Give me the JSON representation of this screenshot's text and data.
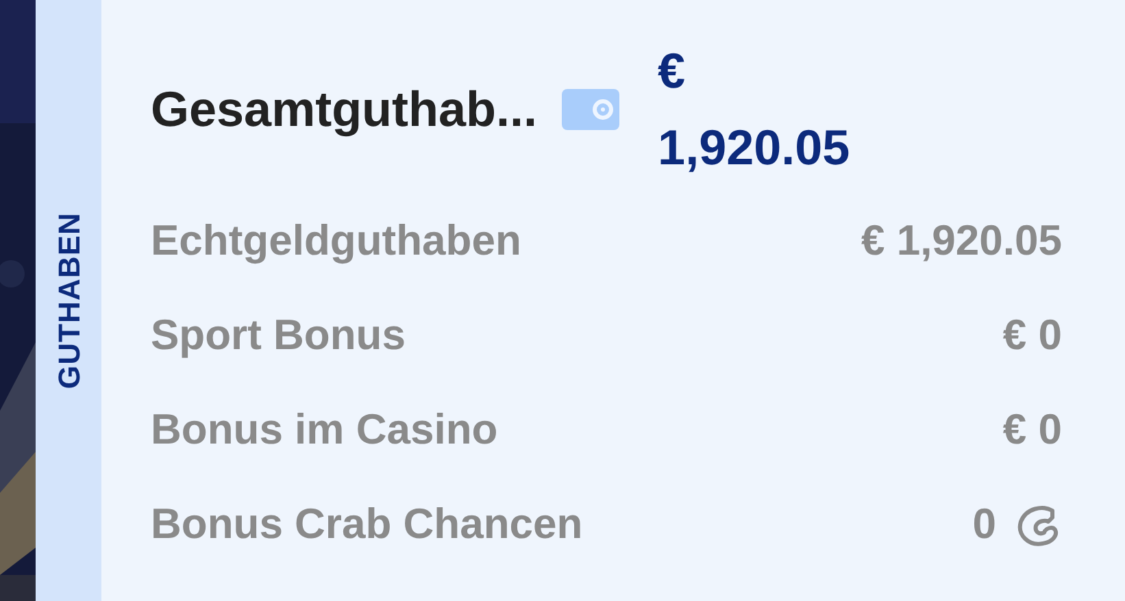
{
  "side_tab": {
    "label": "GUTHABEN"
  },
  "total": {
    "label": "Gesamtguthab...",
    "currency": "€",
    "amount": "1,920.05"
  },
  "rows": [
    {
      "kind": "amount",
      "label": "Echtgeldguthaben",
      "value": "€ 1,920.05"
    },
    {
      "kind": "amount",
      "label": "Sport Bonus",
      "value": "€ 0"
    },
    {
      "kind": "amount",
      "label": "Bonus im Casino",
      "value": "€ 0"
    },
    {
      "kind": "crab",
      "label": "Bonus Crab Chancen",
      "value": "0"
    }
  ]
}
